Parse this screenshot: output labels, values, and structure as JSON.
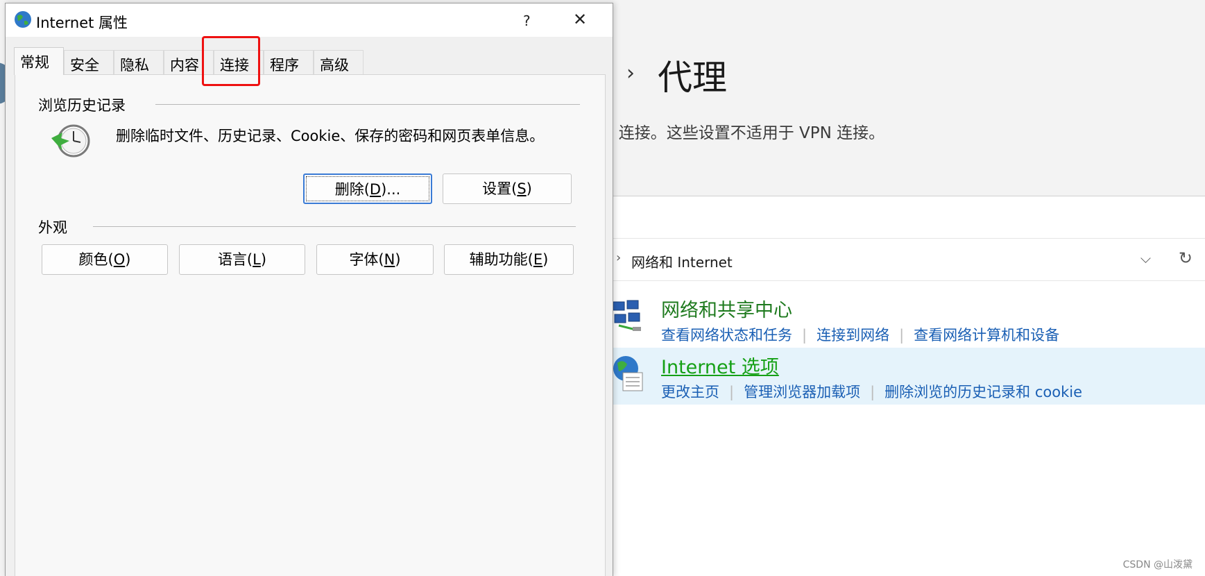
{
  "settings_bg": {
    "title": "代理",
    "description": "i 连接。这些设置不适用于 VPN 连接。"
  },
  "control_panel": {
    "breadcrumb": "网络和 Internet",
    "items": [
      {
        "title": "网络和共享中心",
        "links": [
          "查看网络状态和任务",
          "连接到网络",
          "查看网络计算机和设备"
        ]
      },
      {
        "title": "Internet 选项",
        "links": [
          "更改主页",
          "管理浏览器加载项",
          "删除浏览的历史记录和 cookie"
        ]
      }
    ]
  },
  "dialog": {
    "title": "Internet 属性",
    "help_glyph": "?",
    "close_glyph": "✕",
    "tabs": [
      "常规",
      "安全",
      "隐私",
      "内容",
      "连接",
      "程序",
      "高级"
    ],
    "active_tab": "常规",
    "highlighted_tab": "连接",
    "history": {
      "label": "浏览历史记录",
      "description": "删除临时文件、历史记录、Cookie、保存的密码和网页表单信息。",
      "delete_button": {
        "text": "删除(",
        "key": "D",
        "suffix": ")..."
      },
      "settings_button": {
        "text": "设置(",
        "key": "S",
        "suffix": ")"
      }
    },
    "appearance": {
      "label": "外观",
      "buttons": [
        {
          "text": "颜色(",
          "key": "O",
          "suffix": ")"
        },
        {
          "text": "语言(",
          "key": "L",
          "suffix": ")"
        },
        {
          "text": "字体(",
          "key": "N",
          "suffix": ")"
        },
        {
          "text": "辅助功能(",
          "key": "E",
          "suffix": ")"
        }
      ]
    }
  },
  "watermark": "CSDN @山泼黛",
  "colors": {
    "highlight_box": "#ee1111",
    "link": "#1a5fb4",
    "cp_title_green": "#1e7a1e",
    "selected_row": "#e5f3fb"
  }
}
